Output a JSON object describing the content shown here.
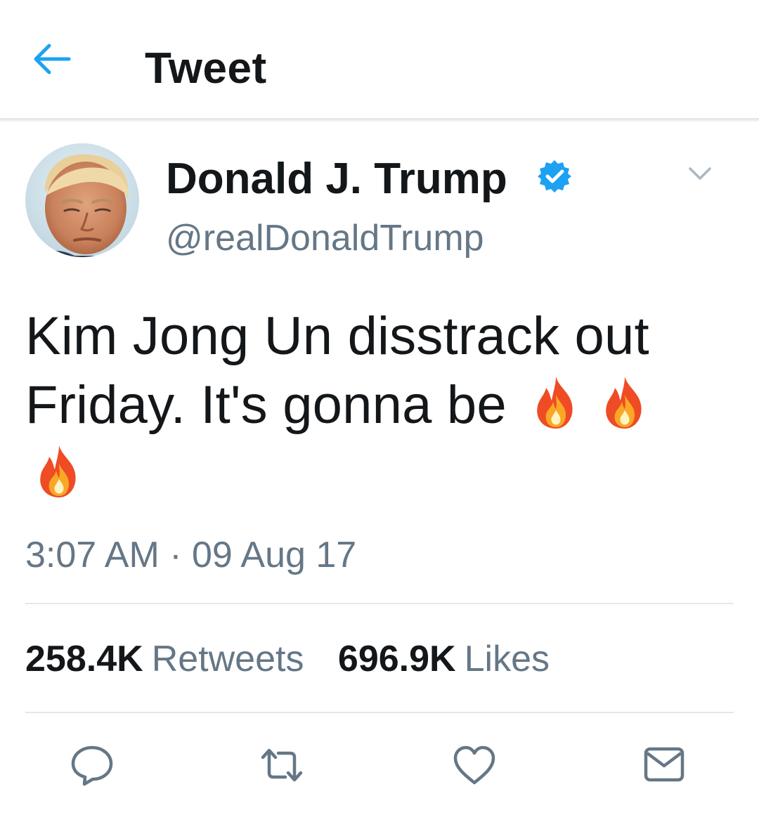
{
  "header": {
    "title": "Tweet",
    "back_icon": "arrow-left-icon",
    "accent_color": "#1da1f2"
  },
  "author": {
    "display_name": "Donald J. Trump",
    "handle": "@realDonaldTrump",
    "verified": true,
    "verified_icon": "verified-badge-icon",
    "verified_color": "#1da1f2",
    "menu_icon": "chevron-down-icon"
  },
  "tweet": {
    "text_line1": "Kim Jong Un disstrack out",
    "text_line2": "Friday. It's gonna be",
    "emoji": [
      "fire",
      "fire",
      "fire"
    ],
    "timestamp": "3:07 AM · 09 Aug 17"
  },
  "stats": {
    "retweets_count": "258.4K",
    "retweets_label": "Retweets",
    "likes_count": "696.9K",
    "likes_label": "Likes"
  },
  "actions": [
    {
      "name": "reply",
      "icon": "reply-icon"
    },
    {
      "name": "retweet",
      "icon": "retweet-icon"
    },
    {
      "name": "like",
      "icon": "heart-icon"
    },
    {
      "name": "direct-message",
      "icon": "envelope-icon"
    }
  ],
  "colors": {
    "text_primary": "#14171a",
    "text_secondary": "#657786",
    "divider": "#e1e8ed",
    "icon_gray": "#657786"
  }
}
